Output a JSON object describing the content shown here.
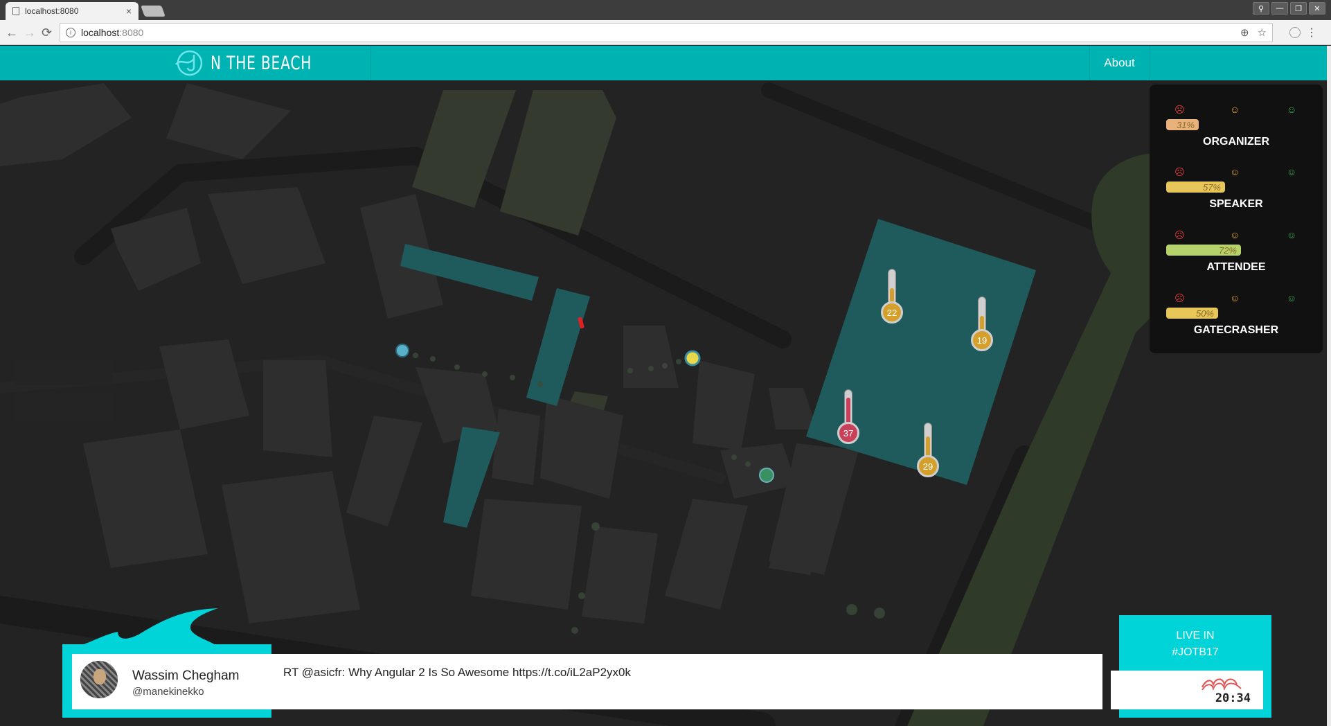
{
  "browser": {
    "tab_title": "localhost:8080",
    "tab_close": "×",
    "url_host": "localhost",
    "url_port": ":8080",
    "info_glyph": "i",
    "back_glyph": "←",
    "forward_glyph": "→",
    "reload_glyph": "⟳",
    "zoom_glyph": "⊕",
    "bookmark_glyph": "☆",
    "menu_glyph": "⋮",
    "window_controls": {
      "user": "⚲",
      "minimize": "—",
      "restore": "❐",
      "close": "✕"
    }
  },
  "header": {
    "brand_text": "N THE BEACH",
    "about_label": "About"
  },
  "mood": {
    "faces": {
      "sad": "☹",
      "neutral": "☺",
      "happy": "☺"
    },
    "rows": [
      {
        "label": "ORGANIZER",
        "percent_text": "31%",
        "value": 31,
        "color": "#e8b27a"
      },
      {
        "label": "SPEAKER",
        "percent_text": "57%",
        "value": 57,
        "color": "#e7c75a"
      },
      {
        "label": "ATTENDEE",
        "percent_text": "72%",
        "value": 72,
        "color": "#b5d36a"
      },
      {
        "label": "GATECRASHER",
        "percent_text": "50%",
        "value": 50,
        "color": "#e7c75a"
      }
    ]
  },
  "thermometers": [
    {
      "value": "22",
      "color": "#d4a02b"
    },
    {
      "value": "19",
      "color": "#d4a02b"
    },
    {
      "value": "37",
      "color": "#c8405a"
    },
    {
      "value": "29",
      "color": "#d4a02b"
    }
  ],
  "tweet": {
    "name": "Wassim Chegham",
    "handle": "@manekinekko",
    "text": "RT @asicfr: Why Angular 2 Is So Awesome https://t.co/iL2aP2yx0k"
  },
  "live": {
    "line1": "LIVE IN",
    "line2": "#JOTB17",
    "time": "20:34"
  },
  "colors": {
    "accent": "#00b3b3",
    "wave": "#00d4d8",
    "zone": "#1f5b5d",
    "map_bg": "#232323"
  }
}
